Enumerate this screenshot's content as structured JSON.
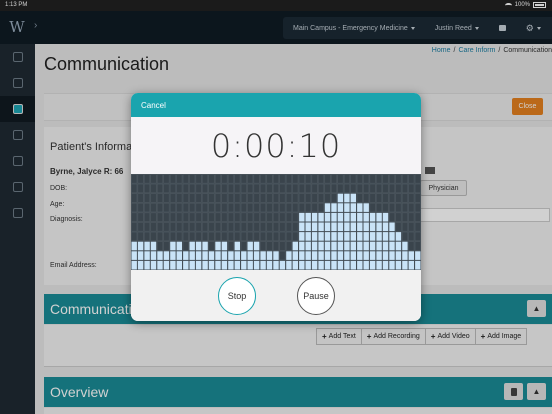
{
  "status_bar": {
    "time": "1:13 PM",
    "battery": "100%"
  },
  "nav": {
    "location": "Main Campus - Emergency Medicine",
    "user": "Justin Reed"
  },
  "breadcrumb": {
    "home": "Home",
    "sep1": "/",
    "care": "Care Inform",
    "sep2": "/",
    "current": "Communication"
  },
  "page_title": "Communication",
  "close_label": "Close",
  "patient": {
    "heading": "Patient's Informa",
    "name": "Byrne, Jalyce R: 66",
    "dob_label": "DOB:",
    "age_label": "Age:",
    "diagnosis_label": "Diagnosis:",
    "email_label": "Email Address:",
    "physician_btn": "Physician"
  },
  "communication_section": {
    "title": "Communicatio"
  },
  "add_buttons": [
    "Add Text",
    "Add Recording",
    "Add Video",
    "Add Image"
  ],
  "overview_section": {
    "title": "Overview"
  },
  "recorder": {
    "cancel_label": "Cancel",
    "timer": "0:00:10",
    "stop_label": "Stop",
    "pause_label": "Pause",
    "levels": [
      3,
      3,
      3,
      3,
      2,
      2,
      3,
      3,
      2,
      3,
      3,
      3,
      2,
      3,
      3,
      2,
      3,
      2,
      3,
      3,
      2,
      2,
      2,
      1,
      2,
      3,
      6,
      6,
      6,
      6,
      7,
      7,
      8,
      8,
      8,
      7,
      7,
      6,
      6,
      6,
      5,
      4,
      3,
      2,
      2
    ],
    "max_level": 10,
    "cell_color": "#c9e3f7",
    "grid_color": "#434d55"
  },
  "colors": {
    "accent": "#1a8c96",
    "close": "#e5801f",
    "navbar": "#0f1b24"
  }
}
